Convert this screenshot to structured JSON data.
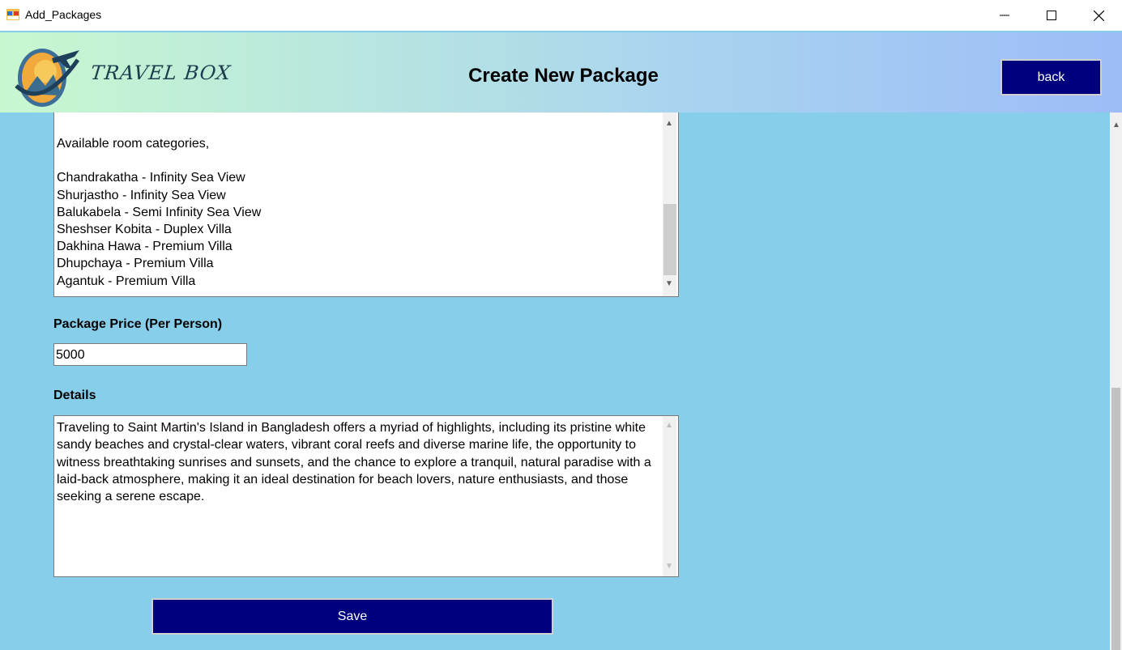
{
  "window": {
    "title": "Add_Packages",
    "minimize_glyph": "—",
    "maximize_glyph": "☐",
    "close_glyph": "✕"
  },
  "header": {
    "brand": "TRAVEL BOX",
    "page_title": "Create New Package",
    "back_label": "back"
  },
  "rooms": {
    "lines": [
      "Available room categories,",
      "",
      "Chandrakatha - Infinity Sea View",
      "Shurjastho - Infinity Sea View",
      "Balukabela - Semi Infinity Sea View",
      "Sheshser Kobita - Duplex Villa",
      "Dakhina Hawa - Premium Villa",
      "Dhupchaya - Premium Villa",
      "Agantuk - Premium Villa"
    ]
  },
  "price": {
    "label": "Package Price (Per Person)",
    "value": "5000"
  },
  "details": {
    "label": "Details",
    "value": "Traveling to Saint Martin's Island in Bangladesh offers a myriad of highlights, including its pristine white sandy beaches and crystal-clear waters, vibrant coral reefs and diverse marine life, the opportunity to witness breathtaking sunrises and sunsets, and the chance to explore a tranquil, natural paradise with a laid-back atmosphere, making it an ideal destination for beach lovers, nature enthusiasts, and those seeking a serene escape."
  },
  "save_label": "Save",
  "icons": {
    "app": "app-window-icon",
    "logo": "airplane-globe-logo",
    "scroll_up": "chevron-up-icon",
    "scroll_down": "chevron-down-icon"
  },
  "colors": {
    "background": "#87CEEB",
    "button": "#00007f",
    "header_start": "#c8f7cf",
    "header_end": "#9dbcf7"
  }
}
